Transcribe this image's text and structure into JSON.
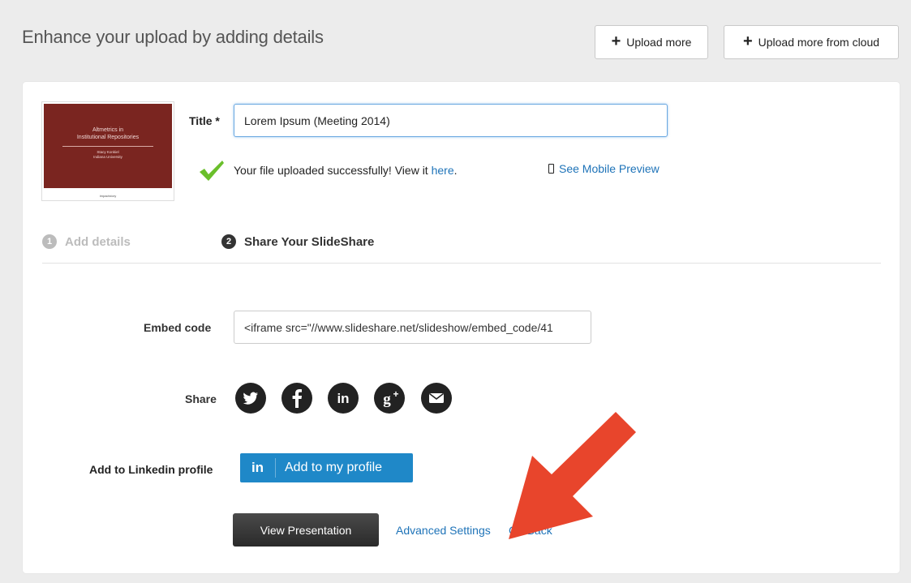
{
  "header": {
    "title": "Enhance your upload by adding details",
    "upload_more_label": "Upload more",
    "upload_cloud_label": "Upload more from cloud"
  },
  "thumbnail": {
    "title": "Altmetrics in\nInstitutional Repositories",
    "subtitle": "Stacy Konkiel\nIndiana University",
    "footer": "impactstory"
  },
  "form": {
    "title_label": "Title *",
    "title_value": "Lorem Ipsum (Meeting 2014)",
    "success_text": "Your file uploaded successfully! View it ",
    "success_link": "here",
    "success_end": ".",
    "mobile_preview": "See Mobile Preview"
  },
  "steps": [
    {
      "num": "1",
      "label": "Add details"
    },
    {
      "num": "2",
      "label": "Share Your SlideShare"
    }
  ],
  "share_section": {
    "embed_label": "Embed code",
    "embed_value": "<iframe src=\"//www.slideshare.net/slideshow/embed_code/41",
    "share_label": "Share",
    "icons": [
      "twitter-icon",
      "facebook-icon",
      "linkedin-icon",
      "google-plus-icon",
      "email-icon"
    ],
    "linkedin_label": "Add to Linkedin profile",
    "linkedin_in": "in",
    "linkedin_button": "Add to my profile"
  },
  "actions": {
    "view_presentation": "View Presentation",
    "advanced_settings": "Advanced Settings",
    "go_back": "Go Back"
  },
  "colors": {
    "link": "#1e73b8",
    "linkedin": "#1f88c8",
    "arrow": "#e8452c",
    "thumbnail": "#7a2520",
    "check": "#6abf2b"
  }
}
